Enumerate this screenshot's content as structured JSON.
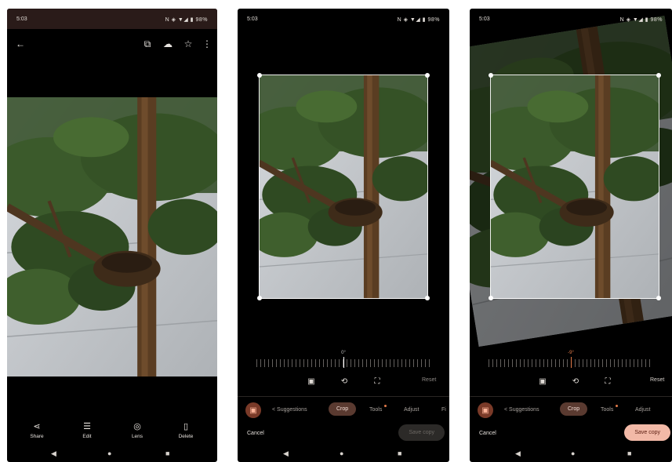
{
  "status": {
    "time": "5:03",
    "indicators": "N ◈ ▼◢ ▮ 98%"
  },
  "colors": {
    "leaf_dark": "#2f4a22",
    "leaf_light": "#5d7c3e",
    "trunk": "#5a3d22",
    "wall": "#c9ccd0",
    "accent": "#f2b9a7"
  },
  "viewer": {
    "topbar_icons": [
      "back-arrow-icon",
      "cast-icon",
      "cloud-upload-icon",
      "star-icon",
      "more-vert-icon"
    ],
    "actions": [
      {
        "label": "Share",
        "icon": "share-icon"
      },
      {
        "label": "Edit",
        "icon": "tune-icon"
      },
      {
        "label": "Lens",
        "icon": "lens-icon"
      },
      {
        "label": "Delete",
        "icon": "trash-icon"
      }
    ]
  },
  "editor_left": {
    "angle": "0°",
    "reset_label": "Reset",
    "tabs": [
      "Suggestions",
      "Crop",
      "Tools",
      "Adjust",
      "Fi"
    ],
    "active_tab": "Crop",
    "cancel_label": "Cancel",
    "save_label": "Save copy"
  },
  "editor_right": {
    "angle": "-9°",
    "reset_label": "Reset",
    "tabs": [
      "Suggestions",
      "Crop",
      "Tools",
      "Adjust"
    ],
    "active_tab": "Crop",
    "cancel_label": "Cancel",
    "save_label": "Save copy"
  },
  "nav_icons": [
    "back-triangle-icon",
    "home-circle-icon",
    "recents-square-icon"
  ]
}
